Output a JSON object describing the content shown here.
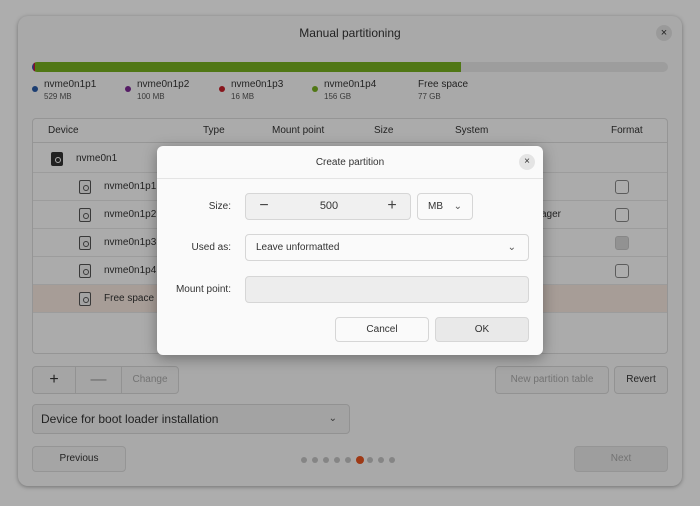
{
  "window": {
    "title": "Manual partitioning",
    "close_glyph": "×"
  },
  "usage": {
    "segments": [
      {
        "name": "nvme0n1p1",
        "color": "#2a5ca8",
        "fraction": 0.0007
      },
      {
        "name": "nvme0n1p2",
        "color": "#7e2a96",
        "fraction": 0.0004
      },
      {
        "name": "nvme0n1p3",
        "color": "#c8202a",
        "fraction": 0.0001
      },
      {
        "name": "nvme0n1p4",
        "color": "#77b020",
        "fraction": 0.67
      }
    ]
  },
  "legend": [
    {
      "name": "nvme0n1p1",
      "size": "529 MB",
      "color": "#2a5ca8"
    },
    {
      "name": "nvme0n1p2",
      "size": "100 MB",
      "color": "#7e2a96"
    },
    {
      "name": "nvme0n1p3",
      "size": "16 MB",
      "color": "#c8202a"
    },
    {
      "name": "nvme0n1p4",
      "size": "156 GB",
      "color": "#77b020"
    },
    {
      "name": "Free space",
      "size": "77 GB"
    }
  ],
  "table": {
    "headers": {
      "device": "Device",
      "type": "Type",
      "mount": "Mount point",
      "size": "Size",
      "system": "System",
      "format": "Format"
    },
    "rows": [
      {
        "device": "nvme0n1",
        "kind": "disk"
      },
      {
        "device": "nvme0n1p1",
        "format": "unchecked"
      },
      {
        "device": "nvme0n1p2",
        "system": "ager",
        "format": "unchecked"
      },
      {
        "device": "nvme0n1p3",
        "format": "disabled"
      },
      {
        "device": "nvme0n1p4",
        "format": "unchecked"
      },
      {
        "device": "Free space",
        "selected": true
      }
    ]
  },
  "toolbar": {
    "add": "+",
    "remove": "—",
    "change": "Change",
    "new_table": "New partition table",
    "revert": "Revert"
  },
  "bootloader": {
    "label": "Device for boot loader installation",
    "chevron": "⌄"
  },
  "nav": {
    "previous": "Previous",
    "next": "Next",
    "step_count": 9,
    "active_step": 6
  },
  "dialog": {
    "title": "Create partition",
    "close_glyph": "×",
    "size_label": "Size:",
    "size_value": "500",
    "minus": "−",
    "plus": "+",
    "unit": "MB",
    "used_as_label": "Used as:",
    "used_as_value": "Leave unformatted",
    "mount_label": "Mount point:",
    "mount_value": "",
    "chevron": "⌄",
    "cancel": "Cancel",
    "ok": "OK"
  }
}
